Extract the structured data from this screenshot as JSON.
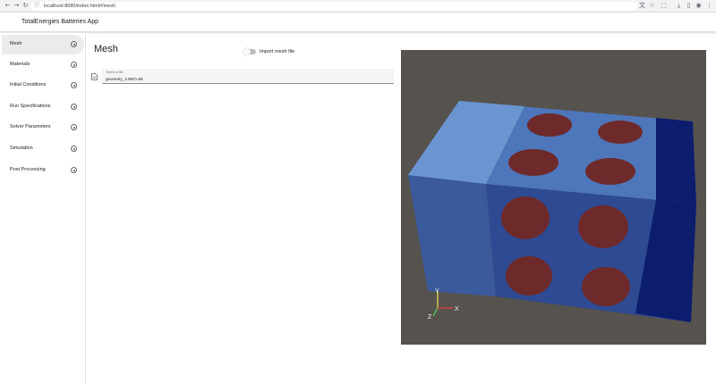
{
  "browser": {
    "url": "localhost:8080/index.html#/mesh",
    "icons": [
      "back-icon",
      "forward-icon",
      "reload-icon",
      "translate-icon",
      "bookmark-star-icon",
      "extension-icon",
      "download-icon",
      "sidepanel-icon",
      "profile-icon",
      "menu-icon"
    ]
  },
  "app": {
    "title": "TotalEnergies Batteries App"
  },
  "sidebar": {
    "items": [
      {
        "label": "Mesh",
        "active": true
      },
      {
        "label": "Materials"
      },
      {
        "label": "Initial Conditions"
      },
      {
        "label": "Run Specifications"
      },
      {
        "label": "Solver Parameters"
      },
      {
        "label": "Simulation"
      },
      {
        "label": "Post Processing"
      }
    ]
  },
  "main": {
    "title": "Mesh",
    "import_toggle_label": "Import mesh file",
    "file_field": {
      "label": "Select a file",
      "value": "geometry_4.NEO.vtk"
    }
  },
  "viewport": {
    "axes": {
      "x": "X",
      "y": "Y",
      "z": "Z"
    },
    "colors": {
      "background": "#56524d",
      "front_face": "#2e4a92",
      "side_face": "#3a5a9c",
      "top_face": "#4d76bb",
      "top_light_strip": "#6a95d0",
      "dark_strip": "#0c1d6e",
      "inclusion": "#6e2a2a"
    }
  }
}
